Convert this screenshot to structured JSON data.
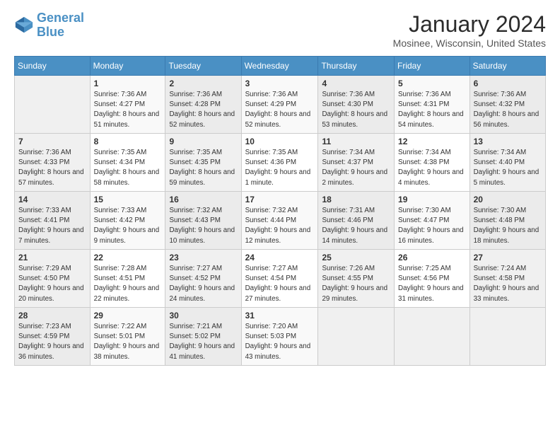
{
  "header": {
    "logo_line1": "General",
    "logo_line2": "Blue",
    "month": "January 2024",
    "location": "Mosinee, Wisconsin, United States"
  },
  "weekdays": [
    "Sunday",
    "Monday",
    "Tuesday",
    "Wednesday",
    "Thursday",
    "Friday",
    "Saturday"
  ],
  "weeks": [
    [
      {
        "day": "",
        "sunrise": "",
        "sunset": "",
        "daylight": ""
      },
      {
        "day": "1",
        "sunrise": "Sunrise: 7:36 AM",
        "sunset": "Sunset: 4:27 PM",
        "daylight": "Daylight: 8 hours and 51 minutes."
      },
      {
        "day": "2",
        "sunrise": "Sunrise: 7:36 AM",
        "sunset": "Sunset: 4:28 PM",
        "daylight": "Daylight: 8 hours and 52 minutes."
      },
      {
        "day": "3",
        "sunrise": "Sunrise: 7:36 AM",
        "sunset": "Sunset: 4:29 PM",
        "daylight": "Daylight: 8 hours and 52 minutes."
      },
      {
        "day": "4",
        "sunrise": "Sunrise: 7:36 AM",
        "sunset": "Sunset: 4:30 PM",
        "daylight": "Daylight: 8 hours and 53 minutes."
      },
      {
        "day": "5",
        "sunrise": "Sunrise: 7:36 AM",
        "sunset": "Sunset: 4:31 PM",
        "daylight": "Daylight: 8 hours and 54 minutes."
      },
      {
        "day": "6",
        "sunrise": "Sunrise: 7:36 AM",
        "sunset": "Sunset: 4:32 PM",
        "daylight": "Daylight: 8 hours and 56 minutes."
      }
    ],
    [
      {
        "day": "7",
        "sunrise": "Sunrise: 7:36 AM",
        "sunset": "Sunset: 4:33 PM",
        "daylight": "Daylight: 8 hours and 57 minutes."
      },
      {
        "day": "8",
        "sunrise": "Sunrise: 7:35 AM",
        "sunset": "Sunset: 4:34 PM",
        "daylight": "Daylight: 8 hours and 58 minutes."
      },
      {
        "day": "9",
        "sunrise": "Sunrise: 7:35 AM",
        "sunset": "Sunset: 4:35 PM",
        "daylight": "Daylight: 8 hours and 59 minutes."
      },
      {
        "day": "10",
        "sunrise": "Sunrise: 7:35 AM",
        "sunset": "Sunset: 4:36 PM",
        "daylight": "Daylight: 9 hours and 1 minute."
      },
      {
        "day": "11",
        "sunrise": "Sunrise: 7:34 AM",
        "sunset": "Sunset: 4:37 PM",
        "daylight": "Daylight: 9 hours and 2 minutes."
      },
      {
        "day": "12",
        "sunrise": "Sunrise: 7:34 AM",
        "sunset": "Sunset: 4:38 PM",
        "daylight": "Daylight: 9 hours and 4 minutes."
      },
      {
        "day": "13",
        "sunrise": "Sunrise: 7:34 AM",
        "sunset": "Sunset: 4:40 PM",
        "daylight": "Daylight: 9 hours and 5 minutes."
      }
    ],
    [
      {
        "day": "14",
        "sunrise": "Sunrise: 7:33 AM",
        "sunset": "Sunset: 4:41 PM",
        "daylight": "Daylight: 9 hours and 7 minutes."
      },
      {
        "day": "15",
        "sunrise": "Sunrise: 7:33 AM",
        "sunset": "Sunset: 4:42 PM",
        "daylight": "Daylight: 9 hours and 9 minutes."
      },
      {
        "day": "16",
        "sunrise": "Sunrise: 7:32 AM",
        "sunset": "Sunset: 4:43 PM",
        "daylight": "Daylight: 9 hours and 10 minutes."
      },
      {
        "day": "17",
        "sunrise": "Sunrise: 7:32 AM",
        "sunset": "Sunset: 4:44 PM",
        "daylight": "Daylight: 9 hours and 12 minutes."
      },
      {
        "day": "18",
        "sunrise": "Sunrise: 7:31 AM",
        "sunset": "Sunset: 4:46 PM",
        "daylight": "Daylight: 9 hours and 14 minutes."
      },
      {
        "day": "19",
        "sunrise": "Sunrise: 7:30 AM",
        "sunset": "Sunset: 4:47 PM",
        "daylight": "Daylight: 9 hours and 16 minutes."
      },
      {
        "day": "20",
        "sunrise": "Sunrise: 7:30 AM",
        "sunset": "Sunset: 4:48 PM",
        "daylight": "Daylight: 9 hours and 18 minutes."
      }
    ],
    [
      {
        "day": "21",
        "sunrise": "Sunrise: 7:29 AM",
        "sunset": "Sunset: 4:50 PM",
        "daylight": "Daylight: 9 hours and 20 minutes."
      },
      {
        "day": "22",
        "sunrise": "Sunrise: 7:28 AM",
        "sunset": "Sunset: 4:51 PM",
        "daylight": "Daylight: 9 hours and 22 minutes."
      },
      {
        "day": "23",
        "sunrise": "Sunrise: 7:27 AM",
        "sunset": "Sunset: 4:52 PM",
        "daylight": "Daylight: 9 hours and 24 minutes."
      },
      {
        "day": "24",
        "sunrise": "Sunrise: 7:27 AM",
        "sunset": "Sunset: 4:54 PM",
        "daylight": "Daylight: 9 hours and 27 minutes."
      },
      {
        "day": "25",
        "sunrise": "Sunrise: 7:26 AM",
        "sunset": "Sunset: 4:55 PM",
        "daylight": "Daylight: 9 hours and 29 minutes."
      },
      {
        "day": "26",
        "sunrise": "Sunrise: 7:25 AM",
        "sunset": "Sunset: 4:56 PM",
        "daylight": "Daylight: 9 hours and 31 minutes."
      },
      {
        "day": "27",
        "sunrise": "Sunrise: 7:24 AM",
        "sunset": "Sunset: 4:58 PM",
        "daylight": "Daylight: 9 hours and 33 minutes."
      }
    ],
    [
      {
        "day": "28",
        "sunrise": "Sunrise: 7:23 AM",
        "sunset": "Sunset: 4:59 PM",
        "daylight": "Daylight: 9 hours and 36 minutes."
      },
      {
        "day": "29",
        "sunrise": "Sunrise: 7:22 AM",
        "sunset": "Sunset: 5:01 PM",
        "daylight": "Daylight: 9 hours and 38 minutes."
      },
      {
        "day": "30",
        "sunrise": "Sunrise: 7:21 AM",
        "sunset": "Sunset: 5:02 PM",
        "daylight": "Daylight: 9 hours and 41 minutes."
      },
      {
        "day": "31",
        "sunrise": "Sunrise: 7:20 AM",
        "sunset": "Sunset: 5:03 PM",
        "daylight": "Daylight: 9 hours and 43 minutes."
      },
      {
        "day": "",
        "sunrise": "",
        "sunset": "",
        "daylight": ""
      },
      {
        "day": "",
        "sunrise": "",
        "sunset": "",
        "daylight": ""
      },
      {
        "day": "",
        "sunrise": "",
        "sunset": "",
        "daylight": ""
      }
    ]
  ]
}
